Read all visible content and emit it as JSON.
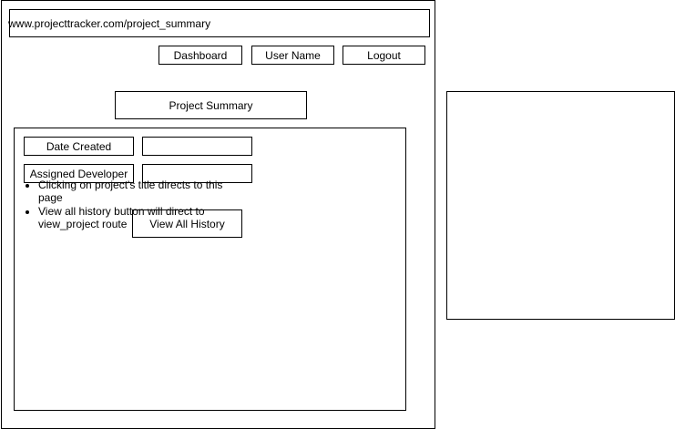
{
  "browser": {
    "url": "www.projecttracker.com/project_summary"
  },
  "nav": {
    "dashboard_label": "Dashboard",
    "user_label": "User Name",
    "logout_label": "Logout"
  },
  "page": {
    "title": "Project Summary",
    "fields": {
      "date_created_label": "Date Created",
      "date_created_value": "",
      "assigned_developer_label": "Assigned Developer",
      "assigned_developer_value": ""
    },
    "history_button_label": "View All History"
  },
  "notes": {
    "items": [
      "Clicking on project's title directs to this page",
      "View all history button will direct to view_project route"
    ]
  }
}
